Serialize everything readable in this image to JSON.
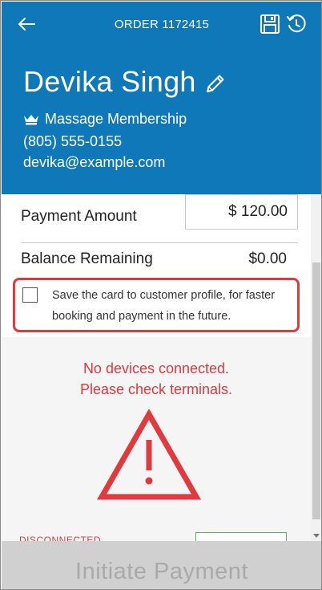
{
  "topbar": {
    "title": "ORDER 1172415",
    "back_icon": "arrow-left-icon",
    "save_icon": "floppy-disk-icon",
    "history_icon": "clock-history-icon"
  },
  "customer": {
    "name": "Devika Singh",
    "membership": "Massage Membership",
    "phone": "(805) 555-0155",
    "email": "devika@example.com",
    "edit_icon": "pencil-icon",
    "membership_icon": "crown-icon"
  },
  "payment": {
    "amount_label": "Payment Amount",
    "amount_value": "$ 120.00",
    "balance_label": "Balance Remaining",
    "balance_value": "$0.00",
    "save_card_text": "Save the card to customer profile, for faster booking and payment in the future.",
    "save_card_checked": false
  },
  "devices": {
    "message_line1": "No devices connected.",
    "message_line2": "Please check terminals.",
    "warning_icon": "warning-triangle-icon",
    "status": "DISCONNECTED"
  },
  "actions": {
    "initiate_label": "Initiate Payment"
  },
  "colors": {
    "header_blue": "#0f78b8",
    "alert_red": "#e0393e",
    "button_disabled": "#d0d0d0",
    "connect_green": "#58b05c"
  }
}
